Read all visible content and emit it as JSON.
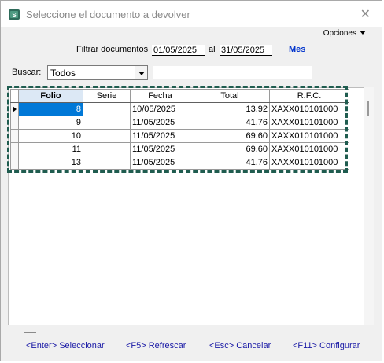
{
  "window": {
    "title": "Seleccione el documento a devolver",
    "close_glyph": "✕",
    "app_icon": "app-icon",
    "options_label": "Opciones"
  },
  "filter": {
    "label": "Filtrar documentos",
    "from_value": "01/05/2025",
    "connector": "al",
    "to_value": "31/05/2025",
    "period_link": "Mes"
  },
  "search": {
    "label": "Buscar:",
    "scope_value": "Todos",
    "text_value": ""
  },
  "table": {
    "headers": [
      "Folio",
      "Serie",
      "Fecha",
      "Total",
      "R.F.C."
    ],
    "rows": [
      {
        "folio": "8",
        "serie": "",
        "fecha": "10/05/2025",
        "total": "13.92",
        "rfc": "XAXX010101000"
      },
      {
        "folio": "9",
        "serie": "",
        "fecha": "11/05/2025",
        "total": "41.76",
        "rfc": "XAXX010101000"
      },
      {
        "folio": "10",
        "serie": "",
        "fecha": "11/05/2025",
        "total": "69.60",
        "rfc": "XAXX010101000"
      },
      {
        "folio": "11",
        "serie": "",
        "fecha": "11/05/2025",
        "total": "69.60",
        "rfc": "XAXX010101000"
      },
      {
        "folio": "13",
        "serie": "",
        "fecha": "11/05/2025",
        "total": "41.76",
        "rfc": "XAXX010101000"
      }
    ],
    "selected_row": 0
  },
  "footer": {
    "select": "<Enter> Seleccionar",
    "refresh": "<F5> Refrescar",
    "cancel": "<Esc> Cancelar",
    "configure": "<F11> Configurar"
  },
  "colors": {
    "highlight_border": "#1f5c4f",
    "selection": "#0078d7",
    "link": "#1a1aa6",
    "period_link": "#0033cc"
  }
}
